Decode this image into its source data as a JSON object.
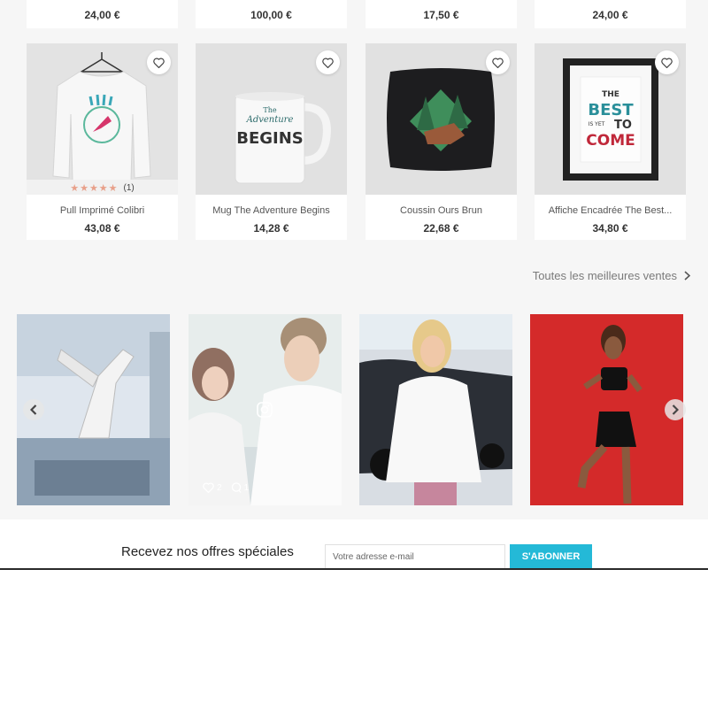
{
  "top_row": [
    {
      "price": "24,00 €"
    },
    {
      "price": "100,00 €"
    },
    {
      "price": "17,50 €"
    },
    {
      "price": "24,00 €"
    }
  ],
  "products": [
    {
      "name": "Pull Imprimé Colibri",
      "price": "43,08 €",
      "rating_count": "(1)",
      "rating": 5,
      "image": "white-sweater-hummingbird-print"
    },
    {
      "name": "Mug The Adventure Begins",
      "price": "14,28 €",
      "image": "white-mug-adventure-begins",
      "mug_text": [
        "The",
        "Adventure",
        "BEGINS"
      ]
    },
    {
      "name": "Coussin Ours Brun",
      "price": "22,68 €",
      "image": "black-cushion-brown-bear"
    },
    {
      "name": "Affiche Encadrée The Best...",
      "price": "34,80 €",
      "image": "framed-poster-best-is-yet-to-come",
      "poster_text": [
        "THE",
        "BEST",
        "IS YET",
        "TO",
        "COME"
      ]
    }
  ],
  "bestsellers_link": {
    "label": "Toutes les meilleures ventes"
  },
  "instagram": {
    "posts": [
      {
        "image": "industrial-robot-arm"
      },
      {
        "image": "couple-smiling",
        "likes": "2",
        "comments": "1"
      },
      {
        "image": "woman-with-car-keys"
      },
      {
        "image": "woman-boxing-red-background"
      }
    ]
  },
  "newsletter": {
    "title": "Recevez nos offres spéciales",
    "placeholder": "Votre adresse e-mail",
    "button_label": "S'ABONNER"
  },
  "colors": {
    "accent": "#24b9d7",
    "background": "#f6f6f6",
    "star": "#e8a08a"
  }
}
